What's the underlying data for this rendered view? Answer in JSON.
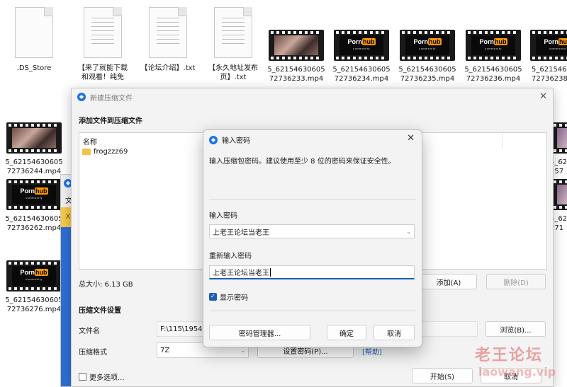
{
  "desktop": {
    "files": [
      {
        "name": ".DS_Store",
        "kind": "doc"
      },
      {
        "name": "【来了就能下载和观看！纯免费！】.txt",
        "line1": "【来了就能下载",
        "line2": "和观看！纯免",
        "line3": "费！】.txt",
        "kind": "txt"
      },
      {
        "name": "【论坛介绍】.txt",
        "kind": "txt"
      },
      {
        "name": "【永久地址发布页】.txt",
        "line1": "【永久地址发布",
        "line2": "页】.txt",
        "kind": "txt"
      },
      {
        "line1": "5_62154630605",
        "line2": "72736233.mp4",
        "kind": "video-photo"
      },
      {
        "line1": "5_62154630605",
        "line2": "72736234.mp4",
        "kind": "video-logo"
      },
      {
        "line1": "5_62154630605",
        "line2": "72736235.mp4",
        "kind": "video-logo"
      },
      {
        "line1": "5_62154630605",
        "line2": "72736236.mp4",
        "kind": "video-logo"
      },
      {
        "line1": "5_621546306",
        "line2": "72736238",
        "kind": "video-logo"
      },
      {
        "line1": "5_62154630605",
        "line2": "72736244.mp4",
        "kind": "video-photo"
      },
      {
        "line1": "5_62154630605",
        "line2": "72736262.mp4",
        "kind": "video-logo"
      },
      {
        "line1": "5_62154630605",
        "line2": "72736276.mp4",
        "kind": "video-logo"
      },
      {
        "line1": "5_6215",
        "line2": "257",
        "kind": "video-photo2"
      },
      {
        "line1": "5_6215",
        "line2": "271",
        "kind": "video-photo2"
      }
    ],
    "logo_word": "Porn",
    "logo_hub": "hub",
    "logo_sub": "community",
    "watermark_cn": "老王论坛",
    "watermark_en": "laowang.vip"
  },
  "main_dialog": {
    "title": "新建压缩文件",
    "close_glyph": "✕",
    "section_add": "添加文件到压缩文件",
    "list_header_name": "名称",
    "list_items": [
      {
        "name": "frogzzz69"
      }
    ],
    "total_size": "总大小: 6.13 GB",
    "add_button": "添加(A)",
    "delete_button": "删除(D)",
    "section_settings": "压缩文件设置",
    "filename_label": "文件名",
    "filename_value": "F:\\115\\1954",
    "browse_button": "浏览(B)...",
    "format_label": "压缩格式",
    "format_value": "7Z",
    "set_password_button": "设置密码(P)...",
    "help_link": "[帮助]",
    "more_options": "更多选项...",
    "start_button": "开始(S)",
    "cancel_button": "取消"
  },
  "behind_dialog": {
    "char": "文",
    "warn": "X"
  },
  "password_dialog": {
    "title": "输入密码",
    "close_glyph": "✕",
    "description": "输入压缩包密码。建议使用至少 8 位的密码来保证安全性。",
    "enter_label": "输入密码",
    "enter_value": "上老王论坛当老王",
    "reenter_label": "重新输入密码",
    "reenter_value": "上老王论坛当老王",
    "show_password": "显示密码",
    "show_password_checked": true,
    "manager_button": "密码管理器...",
    "ok_button": "确定",
    "cancel_button": "取消"
  }
}
